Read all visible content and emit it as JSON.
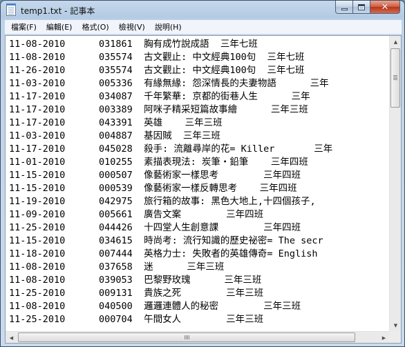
{
  "window": {
    "title": "temp1.txt - 記事本"
  },
  "caption_buttons": {
    "close_label": "✕"
  },
  "menu": [
    {
      "label": "檔案(F)"
    },
    {
      "label": "編輯(E)"
    },
    {
      "label": "格式(O)"
    },
    {
      "label": "檢視(V)"
    },
    {
      "label": "說明(H)"
    }
  ],
  "lines": [
    "11-08-2010      031861  胸有成竹說成語  三年七班",
    "11-08-2010      035574  古文觀止: 中文經典100句  三年七班",
    "11-26-2010      035574  古文觀止: 中文經典100句  三年七班",
    "11-03-2010      005336  有緣無緣: 怨深情長的夫妻物語      三年",
    "11-17-2010      034087  千年繁華: 京都的街巷人生      三年",
    "11-17-2010      003389  阿咪子精采短篇故事繪      三年三班",
    "11-17-2010      043391  英雄    三年三班",
    "11-03-2010      004887  基因賊  三年三班",
    "11-17-2010      045028  殺手: 流離尋岸的花= Killer       三年",
    "11-01-2010      010255  素描表現法: 炭筆‧鉛筆    三年四班",
    "11-15-2010      000507  像藝術家一樣思考        三年四班",
    "11-15-2010      000539  像藝術家一樣反轉思考    三年四班",
    "11-19-2010      042975  旅行箱的故事: 黑色大地上,十四個孩子,",
    "11-09-2010      005661  廣告文案        三年四班",
    "11-25-2010      044426  十四堂人生創意課        三年四班",
    "11-15-2010      034615  時尚考: 流行知識的歷史祕密= The secr",
    "11-18-2010      007444  英格力士: 失敗者的英雄傳奇= English",
    "11-08-2010      037658  迷      三年三班",
    "11-08-2010      039053  巴黎野玫瑰      三年三班",
    "11-25-2010      009131  貴族之死        三年三班",
    "11-08-2010      040500  邏邏連體人的秘密        三年三班",
    "11-25-2010      000704  午間女人        三年三班"
  ]
}
